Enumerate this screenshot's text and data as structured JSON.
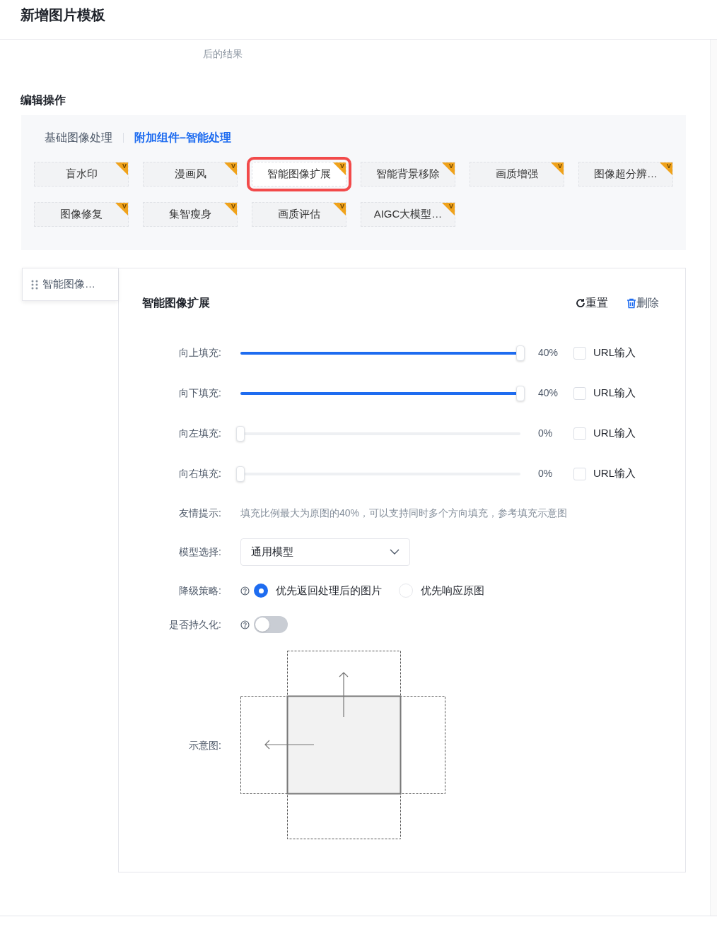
{
  "page_title": "新增图片模板",
  "cut_description": "后的结果",
  "section_title": "编辑操作",
  "tabs": [
    {
      "label": "基础图像处理",
      "selected": false
    },
    {
      "label": "附加组件–智能处理",
      "selected": true
    }
  ],
  "components": [
    {
      "label": "盲水印",
      "badge": "V",
      "selected": false
    },
    {
      "label": "漫画风",
      "badge": "V",
      "selected": false
    },
    {
      "label": "智能图像扩展",
      "badge": "V",
      "selected": true
    },
    {
      "label": "智能背景移除",
      "badge": "V",
      "selected": false
    },
    {
      "label": "画质增强",
      "badge": "V",
      "selected": false
    },
    {
      "label": "图像超分辨…",
      "badge": "V",
      "selected": false
    },
    {
      "label": "图像修复",
      "badge": "V",
      "selected": false
    },
    {
      "label": "集智瘦身",
      "badge": "V",
      "selected": false
    },
    {
      "label": "画质评估",
      "badge": "V",
      "selected": false
    },
    {
      "label": "AIGC大模型…",
      "badge": "V",
      "selected": false
    }
  ],
  "side_tab": {
    "label": "智能图像…"
  },
  "panel": {
    "title": "智能图像扩展",
    "reset": "重置",
    "delete": "删除",
    "sliders": [
      {
        "label": "向上填充:",
        "level": 1.0,
        "reading": "40%",
        "checkbox": "URL输入",
        "checked": false
      },
      {
        "label": "向下填充:",
        "level": 1.0,
        "reading": "40%",
        "checkbox": "URL输入",
        "checked": false
      },
      {
        "label": "向左填充:",
        "level": 0,
        "reading": "0%",
        "checkbox": "URL输入",
        "checked": false
      },
      {
        "label": "向右填充:",
        "level": 0,
        "reading": "0%",
        "checkbox": "URL输入",
        "checked": false
      }
    ],
    "tip": {
      "label": "友情提示:",
      "text": "填充比例最大为原图的40%，可以支持同时多个方向填充，参考填充示意图"
    },
    "model": {
      "label": "模型选择:",
      "value": "通用模型"
    },
    "fallback": {
      "label": "降级策略:",
      "options": [
        {
          "label": "优先返回处理后的图片",
          "selected": true
        },
        {
          "label": "优先响应原图",
          "selected": false
        }
      ]
    },
    "persist": {
      "label": "是否持久化:",
      "on": false
    },
    "diagram": {
      "label": "示意图:"
    }
  }
}
